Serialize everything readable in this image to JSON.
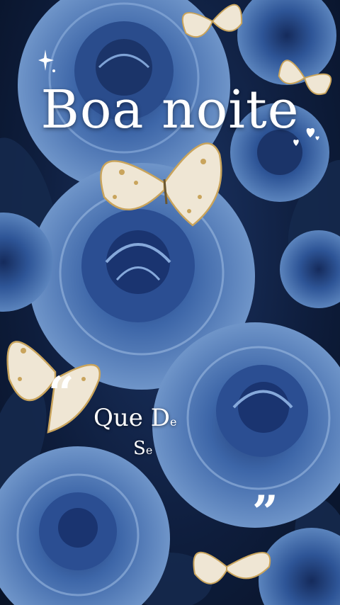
{
  "greeting": "Boa noite",
  "quote": {
    "open_mark": "“",
    "close_mark": "”",
    "line1_a": "Que D",
    "line1_b": "e",
    "line2_a": "S",
    "line2_b": "e"
  },
  "colors": {
    "background": "#0e1d3c",
    "rose_light": "#6f95c9",
    "rose_mid": "#3d66a8",
    "rose_dark": "#1f3a73",
    "butterfly": "#efe6d4",
    "gold": "#c9a45c",
    "text": "#ffffff"
  },
  "decorations": [
    "sparkle-icon",
    "hearts-icon",
    "butterfly",
    "blue-rose"
  ]
}
